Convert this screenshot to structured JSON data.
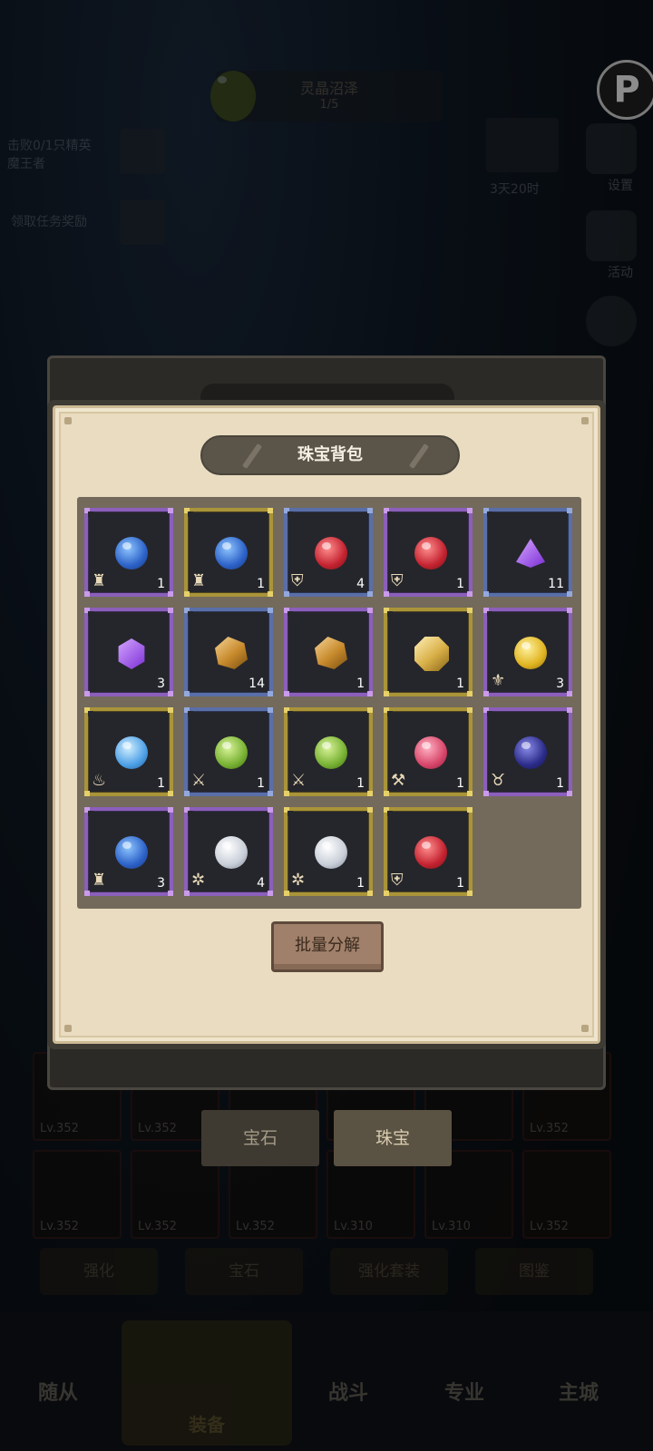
{
  "background": {
    "banner_title": "灵晶沼泽",
    "banner_progress": "1/5",
    "logo_letter": "P",
    "quest_1": "击败0/1只精英魔王者",
    "quest_2": "领取任务奖励",
    "event_label": "活动",
    "event_timer": "3天20时",
    "side_label_1": "设置",
    "side_label_2": "活动",
    "equip_levels_row1": [
      "Lv.352",
      "Lv.352",
      "",
      "352",
      "Lv.352"
    ],
    "equip_levels_row2": [
      "Lv.352",
      "Lv.352",
      "Lv.352",
      "Lv.310",
      "Lv.310",
      "Lv.352"
    ],
    "action_buttons": [
      "强化",
      "宝石",
      "强化套装",
      "图鉴"
    ],
    "nav_items": [
      "随从",
      "装备",
      "战斗",
      "专业",
      "主城"
    ]
  },
  "tabs": [
    {
      "label": "宝石",
      "active": false
    },
    {
      "label": "珠宝",
      "active": true
    }
  ],
  "dialog": {
    "title": "珠宝背包",
    "batch_button": "批量分解"
  },
  "colors": {
    "rarity_purple": "#8b5fba",
    "rarity_gold": "#a99439",
    "rarity_blue": "#5a6ea8",
    "panel_bg": "#e9dcc0",
    "grid_bg": "#736a5c"
  },
  "inventory": [
    {
      "rarity": "purple",
      "gem": "blue-orb",
      "type_icon": "helm-icon",
      "count": "1"
    },
    {
      "rarity": "gold",
      "gem": "blue-orb",
      "type_icon": "helm-icon",
      "count": "1"
    },
    {
      "rarity": "blue",
      "gem": "red-orb",
      "type_icon": "armor-icon",
      "count": "4"
    },
    {
      "rarity": "purple",
      "gem": "red-orb",
      "type_icon": "armor-icon",
      "count": "1"
    },
    {
      "rarity": "blue",
      "gem": "purple-triangle",
      "type_icon": "",
      "count": "11"
    },
    {
      "rarity": "purple",
      "gem": "purple-hexagon",
      "type_icon": "",
      "count": "3"
    },
    {
      "rarity": "blue",
      "gem": "amber-rough",
      "type_icon": "",
      "count": "14"
    },
    {
      "rarity": "purple",
      "gem": "amber-rough",
      "type_icon": "",
      "count": "1"
    },
    {
      "rarity": "gold",
      "gem": "amber-octagon",
      "type_icon": "",
      "count": "1"
    },
    {
      "rarity": "purple",
      "gem": "yellow-orb",
      "type_icon": "wings-icon",
      "count": "3"
    },
    {
      "rarity": "gold",
      "gem": "sky-orb",
      "type_icon": "flame-icon",
      "count": "1"
    },
    {
      "rarity": "blue",
      "gem": "green-orb",
      "type_icon": "trident-icon",
      "count": "1"
    },
    {
      "rarity": "gold",
      "gem": "green-orb",
      "type_icon": "trident-icon",
      "count": "1"
    },
    {
      "rarity": "gold",
      "gem": "pink-orb",
      "type_icon": "hammer-icon",
      "count": "1"
    },
    {
      "rarity": "purple",
      "gem": "indigo-orb",
      "type_icon": "horns-icon",
      "count": "1"
    },
    {
      "rarity": "purple",
      "gem": "blue-orb",
      "type_icon": "helm-icon",
      "count": "3"
    },
    {
      "rarity": "purple",
      "gem": "white-orb",
      "type_icon": "star-icon",
      "count": "4"
    },
    {
      "rarity": "gold",
      "gem": "white-orb",
      "type_icon": "star-icon",
      "count": "1"
    },
    {
      "rarity": "gold",
      "gem": "red-orb",
      "type_icon": "armor-icon",
      "count": "1"
    }
  ]
}
